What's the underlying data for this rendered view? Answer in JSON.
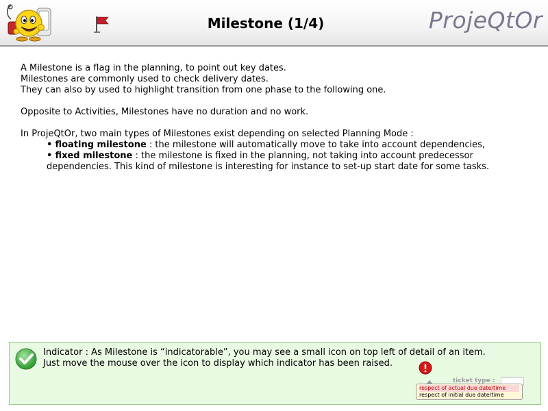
{
  "header": {
    "title": "Milestone (1/4)",
    "brand": "ProjeQtOr",
    "mascot_icon": "smiley-mascot-icon",
    "flag_icon": "milestone-flag-icon",
    "flag_color": "#c0202c"
  },
  "main": {
    "paragraph1": [
      "A Milestone is a flag in the planning, to point out key dates.",
      "Milestones are commonly used to check delivery dates.",
      "They can also by used to highlight transition from one phase to the following one."
    ],
    "paragraph2": "Opposite to Activities, Milestones have no duration and no work.",
    "paragraph3_intro": "In ProjeQtOr, two main types of Milestones exist depending on selected Planning Mode :",
    "bullets": [
      {
        "term": "floating milestone",
        "text": " : the milestone will automatically move to take into account dependencies,"
      },
      {
        "term": "fixed milestone",
        "text": " : the milestone is fixed in the planning, not taking into account predecessor dependencies. This kind of milestone is interesting for instance to set-up start date for some tasks."
      }
    ],
    "bullet_symbol": "•"
  },
  "note": {
    "icon": "check-icon",
    "background": "#e9fae3",
    "line1": "Indicator : As Milestone is “indicatorable”, you may see a small icon on top left of detail of an item.",
    "line2": "Just move the mouse over the icon to display which indicator has been raised."
  },
  "demo": {
    "alert_icon": "exclamation-alert-icon",
    "field_label": "ticket type :",
    "tooltip_lines": [
      "respect of actual due date/time",
      "respect of initial due date/time"
    ]
  }
}
